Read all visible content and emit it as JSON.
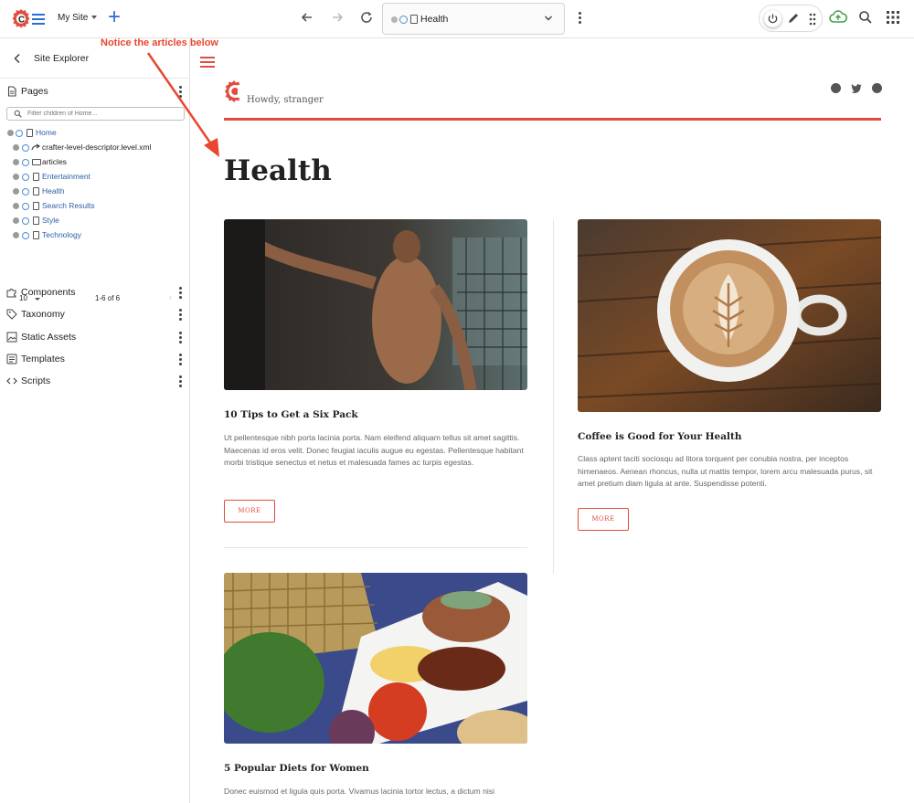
{
  "topbar": {
    "site_name": "My Site",
    "address_text": "Health",
    "icons": [
      "crafter-logo",
      "hamburger-icon",
      "add-icon",
      "back-icon",
      "forward-icon",
      "refresh-icon",
      "chevron-down-icon",
      "kebab-icon",
      "power-icon",
      "pencil-icon",
      "drag-icon",
      "cloud-upload-icon",
      "search-icon",
      "apps-icon"
    ]
  },
  "annotation": {
    "text": "Notice the articles below",
    "color": "#e8462f"
  },
  "sidebar": {
    "title": "Site Explorer",
    "pages_label": "Pages",
    "filter_placeholder": "Filter children of Home...",
    "tree": [
      {
        "label": "Home",
        "type": "page",
        "link": true
      },
      {
        "label": "crafter-level-descriptor.level.xml",
        "type": "level",
        "link": false
      },
      {
        "label": "articles",
        "type": "folder",
        "link": false
      },
      {
        "label": "Entertainment",
        "type": "page",
        "link": true
      },
      {
        "label": "Health",
        "type": "page",
        "link": true
      },
      {
        "label": "Search Results",
        "type": "page",
        "link": true
      },
      {
        "label": "Style",
        "type": "page",
        "link": true
      },
      {
        "label": "Technology",
        "type": "page",
        "link": true
      }
    ],
    "pager": {
      "page_size": "10",
      "range": "1-6 of 6"
    },
    "sections": [
      {
        "label": "Components",
        "icon": "puzzle-icon"
      },
      {
        "label": "Taxonomy",
        "icon": "tag-icon"
      },
      {
        "label": "Static Assets",
        "icon": "image-icon"
      },
      {
        "label": "Templates",
        "icon": "template-icon"
      },
      {
        "label": "Scripts",
        "icon": "code-icon"
      }
    ]
  },
  "preview": {
    "greeting": "Howdy, stranger",
    "page_title": "Health",
    "accent": "#e04c3f",
    "social_icons": [
      "facebook-icon",
      "twitter-icon",
      "google-plus-icon"
    ],
    "articles": [
      {
        "title": "10 Tips to Get a Six Pack",
        "body": "Ut pellentesque nibh porta lacinia porta. Nam eleifend aliquam tellus sit amet sagittis. Maecenas id eros velit. Donec feugiat iaculis augue eu egestas. Pellentesque habitant morbi tristique senectus et netus et malesuada fames ac turpis egestas.",
        "more": "MORE"
      },
      {
        "title": "Coffee is Good for Your Health",
        "body": "Class aptent taciti sociosqu ad litora torquent per conubia nostra, per inceptos himenaeos. Aenean rhoncus, nulla ut mattis tempor, lorem arcu malesuada purus, sit amet pretium diam ligula at ante. Suspendisse potenti.",
        "more": "MORE"
      },
      {
        "title": "5 Popular Diets for Women",
        "body": "Donec euismod et ligula quis porta. Vivamus lacinia tortor lectus, a dictum nisi"
      }
    ]
  }
}
